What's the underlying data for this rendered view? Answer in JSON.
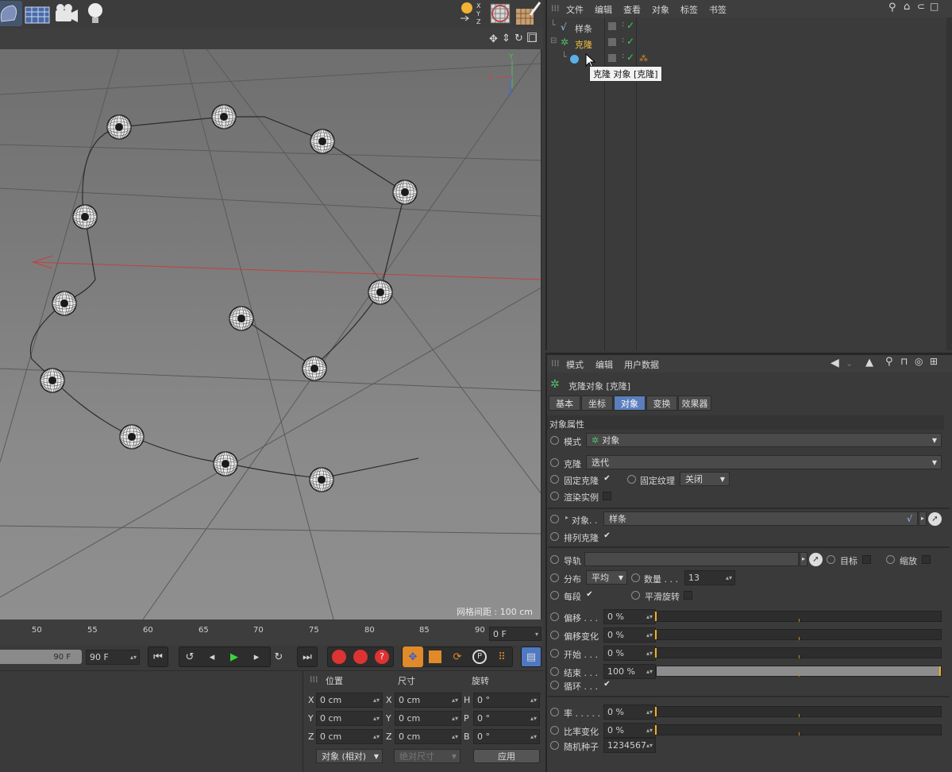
{
  "obj_menu": [
    "文件",
    "编辑",
    "查看",
    "对象",
    "标签",
    "书签"
  ],
  "objects": [
    {
      "name": "样条",
      "active": false
    },
    {
      "name": "克隆",
      "active": true
    },
    {
      "name": "",
      "active": false
    }
  ],
  "tooltip": "克隆 对象 [克隆]",
  "attr_menu": [
    "模式",
    "编辑",
    "用户数据"
  ],
  "attr_title": "克隆对象 [克隆]",
  "tabs": [
    "基本",
    "坐标",
    "对象",
    "变换",
    "效果器"
  ],
  "selected_tab": "对象",
  "section_title": "对象属性",
  "props": {
    "mode_label": "模式",
    "mode_value": "对象",
    "clone_label": "克隆",
    "clone_value": "迭代",
    "fixclone_label": "固定克隆",
    "fixtex_label": "固定纹理",
    "fixtex_value": "关闭",
    "render_label": "渲染实例",
    "object_label": "对象. .",
    "object_value": "样条",
    "arrange_label": "排列克隆",
    "rail_label": "导轨",
    "target_label": "目标",
    "scale_label": "缩放",
    "dist_label": "分布",
    "dist_value": "平均",
    "count_label": "数量 . . .",
    "count_value": "13",
    "every_label": "每段",
    "smooth_label": "平滑旋转",
    "offset_label": "偏移 . . .",
    "offset_value": "0 %",
    "offvar_label": "偏移变化",
    "offvar_value": "0 %",
    "start_label": "开始 . . .",
    "start_value": "0 %",
    "end_label": "结束 . . .",
    "end_value": "100 %",
    "loop_label": "循环 . . .",
    "rate_label": "率 . . . . .",
    "rate_value": "0 %",
    "ratevar_label": "比率变化",
    "ratevar_value": "0 %",
    "seed_label": "随机种子",
    "seed_value": "1234567"
  },
  "slider_fill": {
    "offset": 0,
    "offset_var": 0,
    "start": 0,
    "end": 1.0,
    "rate": 0,
    "rate_var": 0
  },
  "viewport": {
    "grid_label": "网格间距 : 100 cm",
    "axis": {
      "x": "X",
      "y": "Y",
      "z": "Z"
    }
  },
  "ruler_ticks": [
    "50",
    "55",
    "60",
    "65",
    "70",
    "75",
    "80",
    "85",
    "90"
  ],
  "frame_current": "0 F",
  "frame_end_a": "90 F",
  "frame_end_b": "90 F",
  "coords": {
    "headers": [
      "位置",
      "尺寸",
      "旋转"
    ],
    "rows": [
      {
        "a": "X",
        "pos": "0 cm",
        "b": "X",
        "size": "0 cm",
        "c": "H",
        "rot": "0 °"
      },
      {
        "a": "Y",
        "pos": "0 cm",
        "b": "Y",
        "size": "0 cm",
        "c": "P",
        "rot": "0 °"
      },
      {
        "a": "Z",
        "pos": "0 cm",
        "b": "Z",
        "size": "0 cm",
        "c": "B",
        "rot": "0 °"
      }
    ],
    "mode": "对象 (相对)",
    "sizemode": "绝对尺寸",
    "apply": "应用"
  },
  "colors": {
    "accent": "#5b7fbd",
    "active_obj": "#f0c040",
    "check": "#3ccf4e"
  }
}
